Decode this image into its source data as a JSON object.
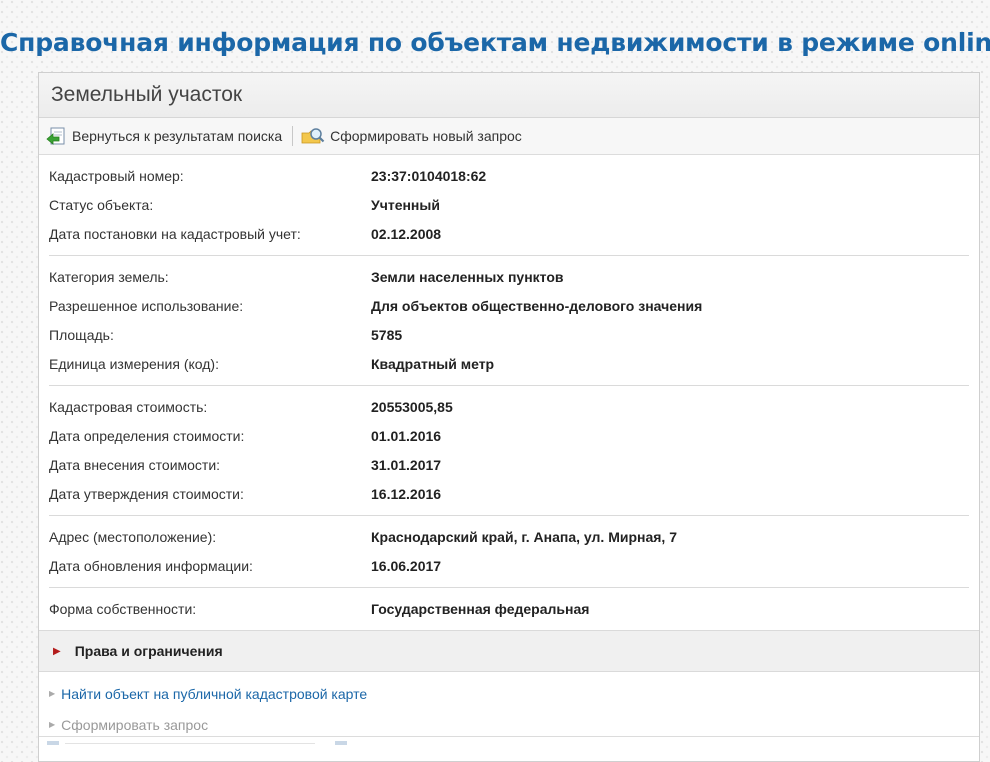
{
  "page": {
    "title": "Справочная информация по объектам недвижимости в режиме online"
  },
  "panel": {
    "header": "Земельный участок",
    "toolbar": {
      "back_label": "Вернуться к результатам поиска",
      "new_request_label": "Сформировать новый запрос"
    },
    "groups": [
      {
        "rows": [
          {
            "label": "Кадастровый номер:",
            "value": "23:37:0104018:62"
          },
          {
            "label": "Статус объекта:",
            "value": "Учтенный"
          },
          {
            "label": "Дата постановки на кадастровый учет:",
            "value": "02.12.2008"
          }
        ]
      },
      {
        "rows": [
          {
            "label": "Категория земель:",
            "value": "Земли населенных пунктов"
          },
          {
            "label": "Разрешенное использование:",
            "value": "Для объектов общественно-делового значения"
          },
          {
            "label": "Площадь:",
            "value": "5785"
          },
          {
            "label": "Единица измерения (код):",
            "value": "Квадратный метр"
          }
        ]
      },
      {
        "rows": [
          {
            "label": "Кадастровая стоимость:",
            "value": "20553005,85"
          },
          {
            "label": "Дата определения стоимости:",
            "value": "01.01.2016"
          },
          {
            "label": "Дата внесения стоимости:",
            "value": "31.01.2017"
          },
          {
            "label": "Дата утверждения стоимости:",
            "value": "16.12.2016"
          }
        ]
      },
      {
        "rows": [
          {
            "label": "Адрес (местоположение):",
            "value": "Краснодарский край, г. Анапа, ул. Мирная, 7"
          },
          {
            "label": "Дата обновления информации:",
            "value": "16.06.2017"
          }
        ]
      },
      {
        "rows": [
          {
            "label": "Форма собственности:",
            "value": "Государственная федеральная"
          }
        ]
      }
    ],
    "rights_section": "Права и ограничения",
    "links": {
      "map_link": "Найти объект на публичной кадастровой карте",
      "request_link": "Сформировать запрос"
    }
  },
  "colors": {
    "title_blue": "#1b67a8",
    "link_blue": "#1b67a8",
    "rights_arrow": "#b31b1b",
    "muted_link": "#999999"
  },
  "icons": {
    "back": "back-arrow-document-icon",
    "new_request": "magnifier-folder-icon",
    "rights_toggle": "triangle-right-icon",
    "link_bullet": "small-triangle-right-icon"
  }
}
